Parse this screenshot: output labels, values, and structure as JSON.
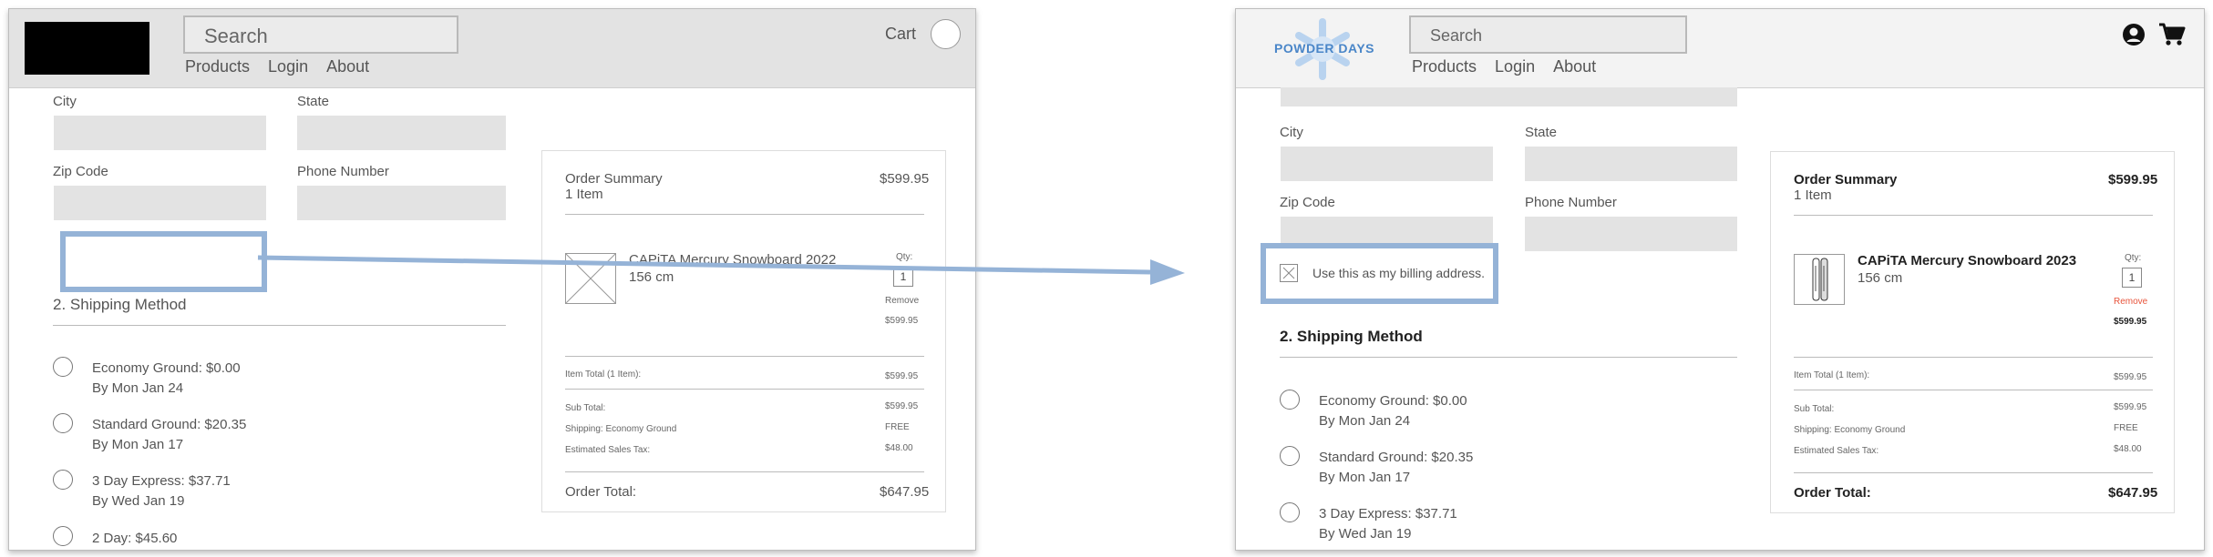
{
  "colors": {
    "accent": "#95b3d7",
    "remove": "#e8543b",
    "field": "#e3e3e3"
  },
  "left": {
    "header": {
      "search_placeholder": "Search",
      "nav": [
        "Products",
        "Login",
        "About"
      ],
      "cart_label": "Cart"
    },
    "form": {
      "city_label": "City",
      "state_label": "State",
      "zip_label": "Zip Code",
      "phone_label": "Phone Number"
    },
    "shipping": {
      "title": "2. Shipping Method",
      "options": [
        {
          "name": "Economy Ground: $0.00",
          "eta": "By Mon Jan 24"
        },
        {
          "name": "Standard Ground: $20.35",
          "eta": "By Mon Jan 17"
        },
        {
          "name": "3 Day Express: $37.71",
          "eta": "By Wed Jan 19"
        },
        {
          "name": "2 Day: $45.60",
          "eta": ""
        }
      ]
    },
    "summary": {
      "title": "Order Summary",
      "count": "1 Item",
      "total_header": "$599.95",
      "product_name": "CAPiTA Mercury Snowboard 2022",
      "product_size": "156 cm",
      "qty_label": "Qty:",
      "qty": "1",
      "remove": "Remove",
      "line_price": "$599.95",
      "item_total_label": "Item Total (1 Item):",
      "item_total": "$599.95",
      "subtotal_label": "Sub Total:",
      "subtotal": "$599.95",
      "shipping_label": "Shipping: Economy Ground",
      "shipping": "FREE",
      "tax_label": "Estimated Sales Tax:",
      "tax": "$48.00",
      "order_total_label": "Order Total:",
      "order_total": "$647.95"
    }
  },
  "right": {
    "header": {
      "logo_text": "POWDER DAYS",
      "search_placeholder": "Search",
      "nav": [
        "Products",
        "Login",
        "About"
      ],
      "icons": [
        "user-icon",
        "cart-icon"
      ]
    },
    "form": {
      "city_label": "City",
      "state_label": "State",
      "zip_label": "Zip Code",
      "phone_label": "Phone Number",
      "billing_label": "Use this as my billing address."
    },
    "shipping": {
      "title": "2. Shipping Method",
      "options": [
        {
          "name": "Economy Ground: $0.00",
          "eta": "By Mon Jan 24"
        },
        {
          "name": "Standard Ground: $20.35",
          "eta": "By Mon Jan 17"
        },
        {
          "name": "3 Day Express: $37.71",
          "eta": "By Wed Jan 19"
        }
      ]
    },
    "summary": {
      "title": "Order Summary",
      "count": "1 Item",
      "total_header": "$599.95",
      "product_name": "CAPiTA Mercury Snowboard 2023",
      "product_size": "156 cm",
      "qty_label": "Qty:",
      "qty": "1",
      "remove": "Remove",
      "line_price": "$599.95",
      "item_total_label": "Item Total (1 Item):",
      "item_total": "$599.95",
      "subtotal_label": "Sub Total:",
      "subtotal": "$599.95",
      "shipping_label": "Shipping: Economy Ground",
      "shipping": "FREE",
      "tax_label": "Estimated Sales Tax:",
      "tax": "$48.00",
      "order_total_label": "Order Total:",
      "order_total": "$647.95"
    }
  }
}
